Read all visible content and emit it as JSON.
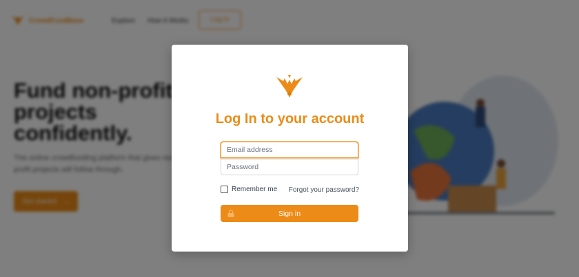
{
  "nav": {
    "brand": "CrowdFundBase",
    "links": [
      "Explore",
      "How It Works"
    ],
    "login": "Log In"
  },
  "hero": {
    "title": "Fund non-profit\nprojects\nconfidently.",
    "subtitle": "The online crowdfunding platform that gives non-profit projects will follow through.",
    "cta": "Get started"
  },
  "modal": {
    "title": "Log In to your account",
    "email_placeholder": "Email address",
    "password_placeholder": "Password",
    "remember_label": "Remember me",
    "forgot_label": "Forgot your password?",
    "signin_label": "Sign in"
  },
  "colors": {
    "accent": "#ec8b17",
    "overlay": "rgba(0,0,0,0.5)"
  },
  "icons": {
    "logo": "eagle-logo-icon",
    "lock": "lock-icon",
    "cta_arrow": "arrow-right-icon"
  }
}
